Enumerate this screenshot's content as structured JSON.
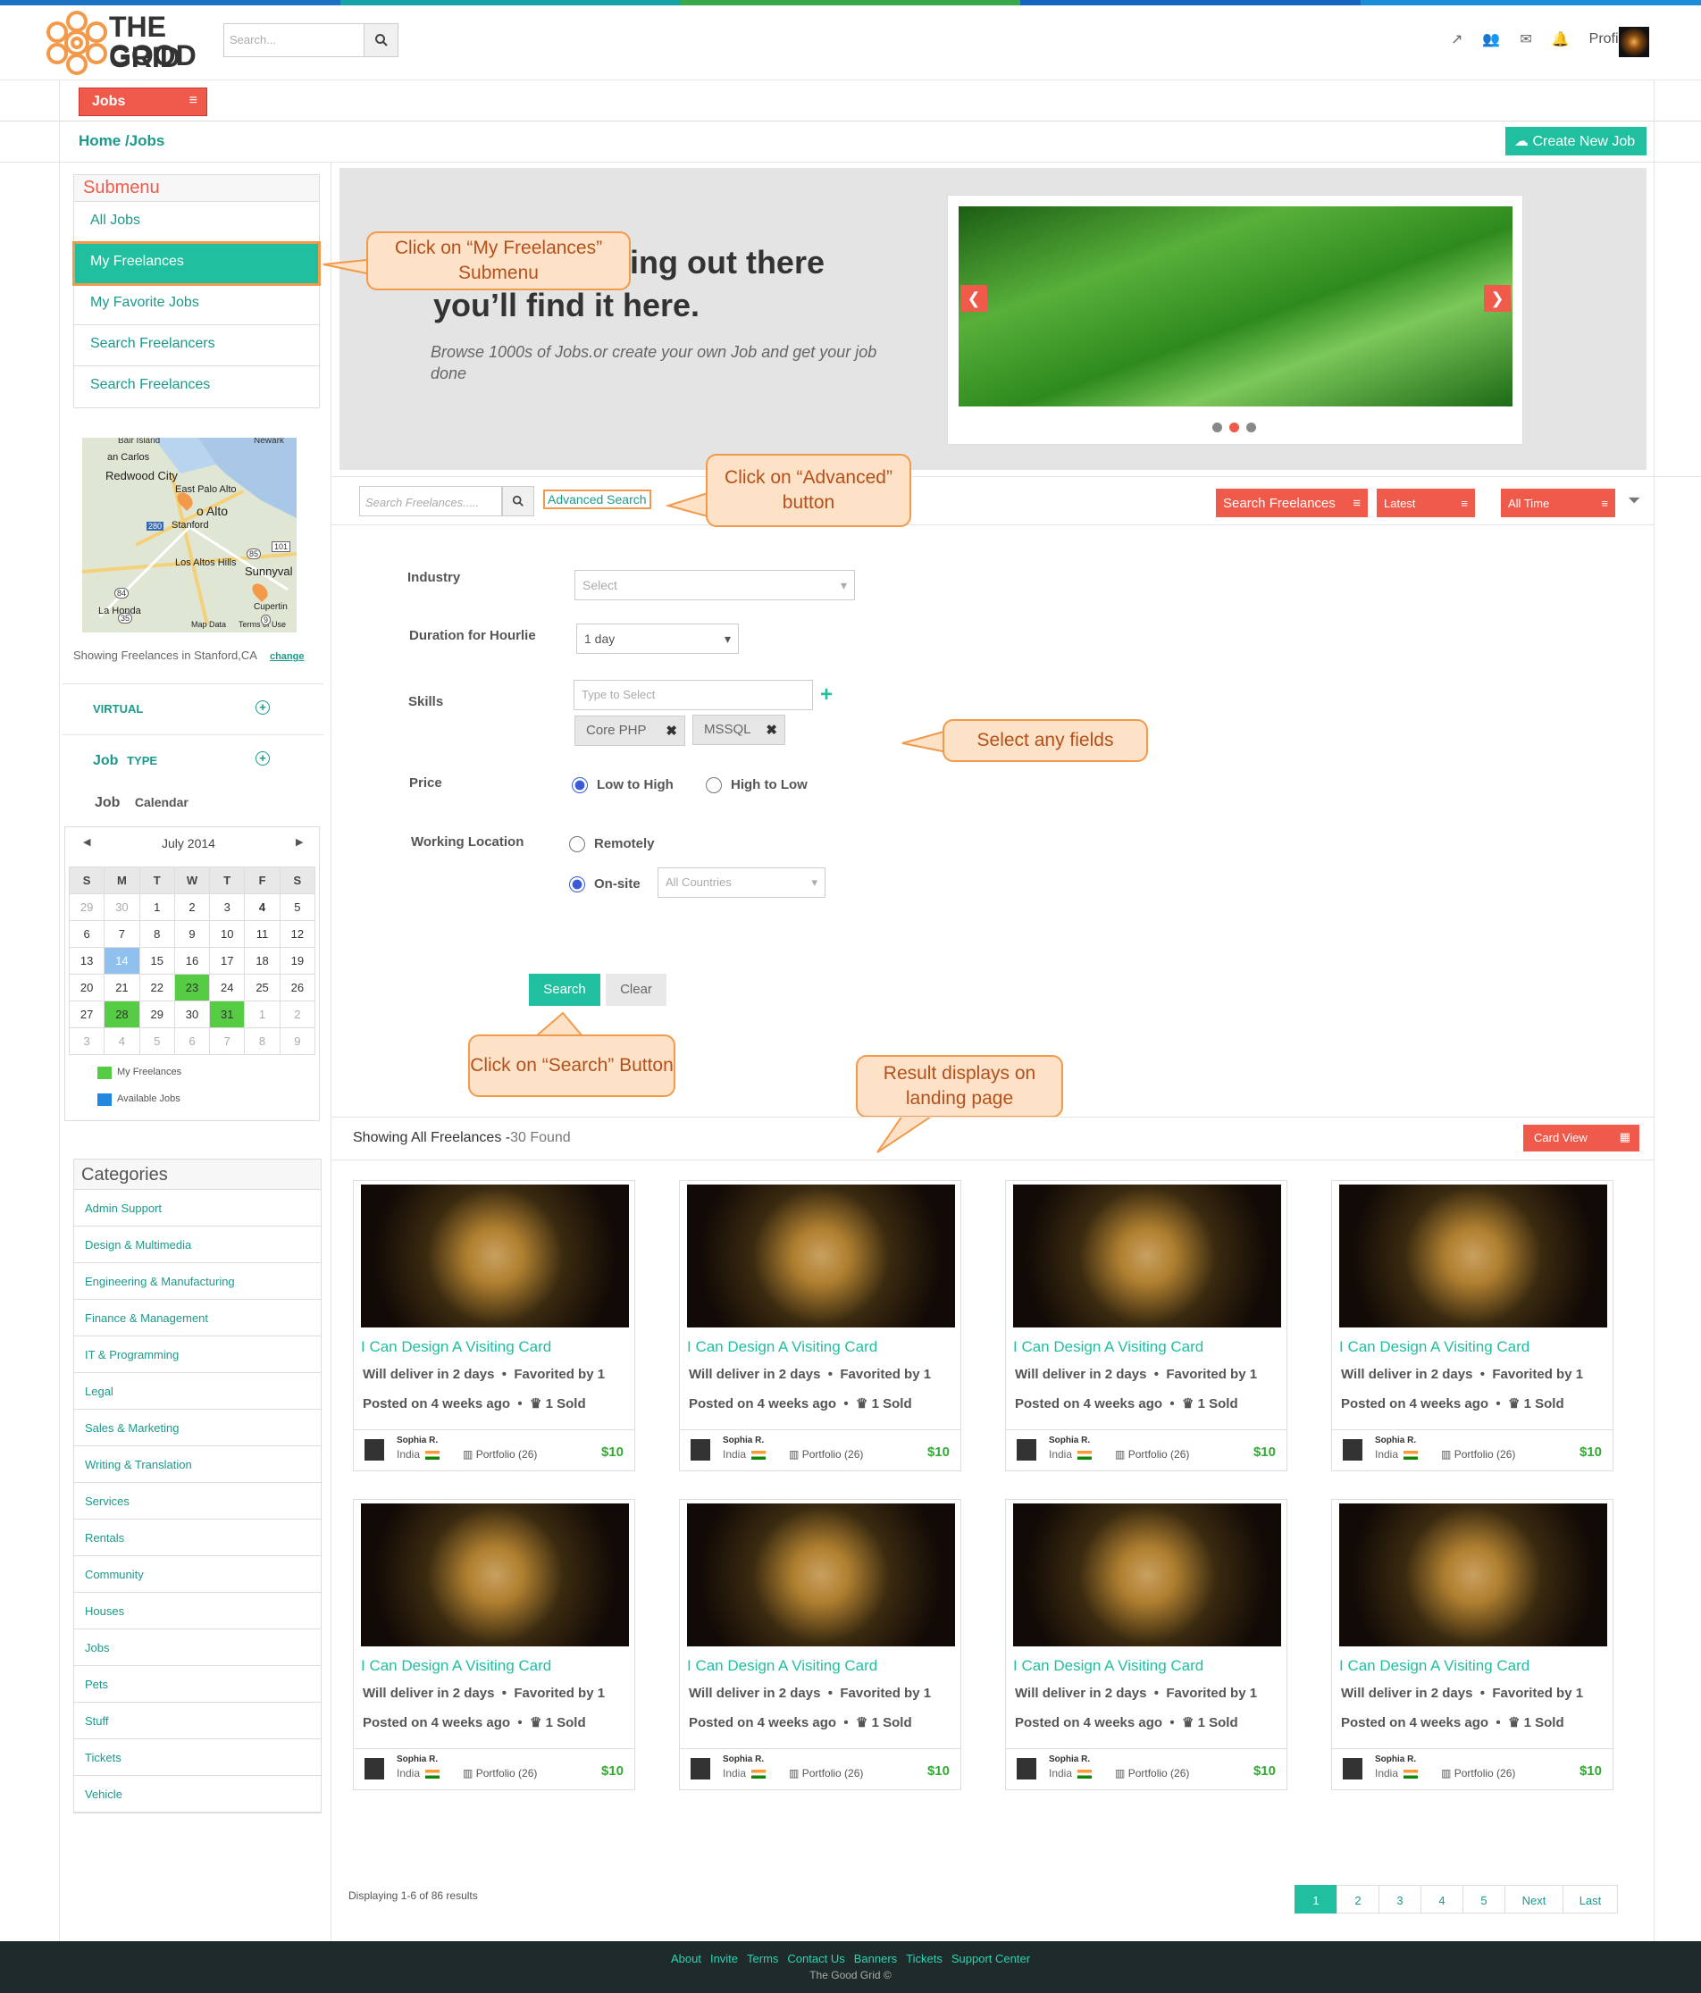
{
  "header": {
    "logo_text_top": "THE GOOD",
    "logo_text_bottom": "GRID",
    "search_placeholder": "Search...",
    "profile_label": "Profile",
    "stripe_colors": [
      "#1b72c2",
      "#16a3a8",
      "#37a94a",
      "#1565c0",
      "#1a8fd8"
    ]
  },
  "nav": {
    "jobs_label": "Jobs",
    "breadcrumb": "Home /Jobs",
    "create_button": "Create New Job"
  },
  "submenu": {
    "title": "Submenu",
    "items": [
      "All Jobs",
      "My Freelances",
      "My Favorite Jobs",
      "Search Freelancers",
      "Search Freelances"
    ]
  },
  "map": {
    "labels": [
      "Bair Island",
      "Newark",
      "an Carlos",
      "Redwood City",
      "East Palo Alto",
      "o Alto",
      "Stanford",
      "Los Altos Hills",
      "Sunnyval",
      "La Honda",
      "Cupertin",
      "Map Data",
      "Terms of Use"
    ],
    "road_numbers": [
      "280",
      "85",
      "101",
      "84",
      "35",
      "9"
    ]
  },
  "location": {
    "text": "Showing Freelances in Stanford,CA",
    "change_link": "change"
  },
  "filters": {
    "virtual": "VIRTUAL",
    "job_type_a": "Job",
    "job_type_b": "TYPE",
    "calendar_a": "Job",
    "calendar_b": "Calendar"
  },
  "calendar": {
    "month": "July 2014",
    "weekdays": [
      "S",
      "M",
      "T",
      "W",
      "T",
      "F",
      "S"
    ],
    "weeks": [
      [
        "29",
        "30",
        "1",
        "2",
        "3",
        "4",
        "5"
      ],
      [
        "6",
        "7",
        "8",
        "9",
        "10",
        "11",
        "12"
      ],
      [
        "13",
        "14",
        "15",
        "16",
        "17",
        "18",
        "19"
      ],
      [
        "20",
        "21",
        "22",
        "23",
        "24",
        "25",
        "26"
      ],
      [
        "27",
        "28",
        "29",
        "30",
        "31",
        "1",
        "2"
      ],
      [
        "3",
        "4",
        "5",
        "6",
        "7",
        "8",
        "9"
      ]
    ],
    "legend_freelances": "My Freelances",
    "legend_jobs": "Available Jobs",
    "freelance_color": "#55cc44",
    "jobs_color": "#2288dd",
    "today_color": "#8fc0ee"
  },
  "categories": {
    "title": "Categories",
    "items": [
      "Admin Support",
      "Design & Multimedia",
      "Engineering & Manufacturing",
      "Finance & Management",
      "IT & Programming",
      "Legal",
      "Sales & Marketing",
      "Writing & Translation",
      "Services",
      "Rentals",
      "Community",
      "Houses",
      "Jobs",
      "Pets",
      "Stuff",
      "Tickets",
      "Vehicle"
    ]
  },
  "hero": {
    "line1": "ing out there",
    "line2": "you’ll find it here.",
    "sub": "Browse 1000s of Jobs.or create your own Job and get your job done"
  },
  "searchbar": {
    "placeholder": "Search Freelances.....",
    "advanced_label": "Advanced Search",
    "dropdown1": "Search Freelances",
    "dropdown2": "Latest",
    "dropdown3": "All Time"
  },
  "form": {
    "industry_label": "Industry",
    "industry_value": "Select",
    "duration_label": "Duration for Hourlie",
    "duration_value": "1 day",
    "skills_label": "Skills",
    "skills_placeholder": "Type to Select",
    "skill_tags": [
      "Core PHP",
      "MSSQL"
    ],
    "price_label": "Price",
    "price_low": "Low to High",
    "price_high": "High to Low",
    "location_label": "Working Location",
    "remote": "Remotely",
    "onsite": "On-site",
    "countries": "All Countries",
    "search_btn": "Search",
    "clear_btn": "Clear"
  },
  "callouts": {
    "c1": "Click on “My Freelances” Submenu",
    "c2": "Click on “Advanced” button",
    "c3": "Select any fields",
    "c4": "Click on “Search” Button",
    "c5": "Result displays on landing page"
  },
  "results": {
    "heading": "Showing All Freelances -",
    "count": "30 Found",
    "card_view": "Card View",
    "cards": [
      {
        "title": "I Can Design A Visiting Card",
        "deliver": "Will deliver in 2 days",
        "fav": "Favorited by 1",
        "posted": "Posted on 4 weeks ago",
        "sold": "1 Sold",
        "seller": "Sophia R.",
        "country": "India",
        "portfolio": "Portfolio (26)",
        "price": "$10"
      },
      {
        "title": "I Can Design A Visiting Card",
        "deliver": "Will deliver in 2 days",
        "fav": "Favorited by 1",
        "posted": "Posted on 4 weeks ago",
        "sold": "1 Sold",
        "seller": "Sophia R.",
        "country": "India",
        "portfolio": "Portfolio (26)",
        "price": "$10"
      },
      {
        "title": "I Can Design A Visiting Card",
        "deliver": "Will deliver in 2 days",
        "fav": "Favorited by 1",
        "posted": "Posted on 4 weeks ago",
        "sold": "1 Sold",
        "seller": "Sophia R.",
        "country": "India",
        "portfolio": "Portfolio (26)",
        "price": "$10"
      },
      {
        "title": "I Can Design A Visiting Card",
        "deliver": "Will deliver in 2 days",
        "fav": "Favorited by 1",
        "posted": "Posted on 4 weeks ago",
        "sold": "1 Sold",
        "seller": "Sophia R.",
        "country": "India",
        "portfolio": "Portfolio (26)",
        "price": "$10"
      },
      {
        "title": "I Can Design A Visiting Card",
        "deliver": "Will deliver in 2 days",
        "fav": "Favorited by 1",
        "posted": "Posted on 4 weeks ago",
        "sold": "1 Sold",
        "seller": "Sophia R.",
        "country": "India",
        "portfolio": "Portfolio (26)",
        "price": "$10"
      },
      {
        "title": "I Can Design A Visiting Card",
        "deliver": "Will deliver in 2 days",
        "fav": "Favorited by 1",
        "posted": "Posted on 4 weeks ago",
        "sold": "1 Sold",
        "seller": "Sophia R.",
        "country": "India",
        "portfolio": "Portfolio (26)",
        "price": "$10"
      },
      {
        "title": "I Can Design A Visiting Card",
        "deliver": "Will deliver in 2 days",
        "fav": "Favorited by 1",
        "posted": "Posted on 4 weeks ago",
        "sold": "1 Sold",
        "seller": "Sophia R.",
        "country": "India",
        "portfolio": "Portfolio (26)",
        "price": "$10"
      },
      {
        "title": "I Can Design A Visiting Card",
        "deliver": "Will deliver in 2 days",
        "fav": "Favorited by 1",
        "posted": "Posted on 4 weeks ago",
        "sold": "1 Sold",
        "seller": "Sophia R.",
        "country": "India",
        "portfolio": "Portfolio (26)",
        "price": "$10"
      }
    ]
  },
  "pagination": {
    "summary": "Displaying 1-6 of 86 results",
    "pages": [
      "1",
      "2",
      "3",
      "4",
      "5"
    ],
    "next": "Next",
    "last": "Last"
  },
  "footer": {
    "links": [
      "About",
      "Invite",
      "Terms",
      "Contact Us",
      "Banners",
      "Tickets",
      "Support Center"
    ],
    "copyright": "The Good Grid ©"
  }
}
